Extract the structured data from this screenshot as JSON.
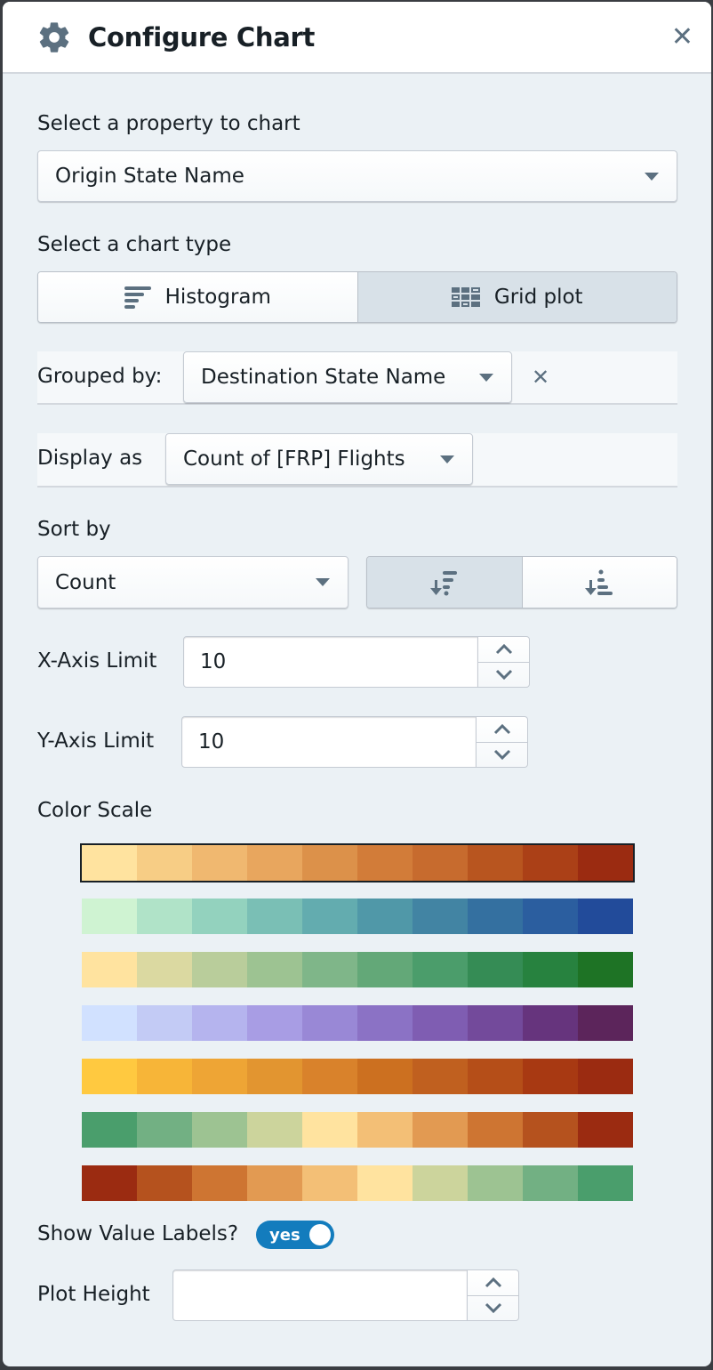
{
  "dialog": {
    "title": "Configure Chart",
    "title_icon": "gear-icon",
    "close_icon": "close-icon"
  },
  "property": {
    "label": "Select a property to chart",
    "value": "Origin State Name"
  },
  "chart_type": {
    "label": "Select a chart type",
    "options": [
      {
        "label": "Histogram",
        "icon": "histogram-icon",
        "active": false
      },
      {
        "label": "Grid plot",
        "icon": "grid-plot-icon",
        "active": true
      }
    ]
  },
  "grouped_by": {
    "label": "Grouped by:",
    "value": "Destination State Name"
  },
  "display_as": {
    "label": "Display as",
    "value": "Count of [FRP] Flights"
  },
  "sort": {
    "label": "Sort by",
    "value": "Count",
    "directions": [
      {
        "name": "sort-descending",
        "active": true
      },
      {
        "name": "sort-ascending",
        "active": false
      }
    ]
  },
  "x_axis_limit": {
    "label": "X-Axis Limit",
    "value": "10"
  },
  "y_axis_limit": {
    "label": "Y-Axis Limit",
    "value": "10"
  },
  "color_scale": {
    "label": "Color Scale",
    "selected_index": 0,
    "scales": [
      [
        "#ffe39f",
        "#f7cd85",
        "#f0b870",
        "#e8a65e",
        "#dc914a",
        "#d27c39",
        "#c76b2e",
        "#b8551f",
        "#ab4017",
        "#9b2b11"
      ],
      [
        "#cff3d2",
        "#b0e3c8",
        "#93d2be",
        "#7abfb5",
        "#63acaf",
        "#5098a8",
        "#4284a3",
        "#3470a0",
        "#2b5e9f",
        "#224b9a"
      ],
      [
        "#ffe39f",
        "#dbd9a1",
        "#b9cd9b",
        "#9dc392",
        "#7fb689",
        "#63a878",
        "#4b9d6b",
        "#358c55",
        "#27823f",
        "#1e7325"
      ],
      [
        "#d1e1ff",
        "#c3cbf5",
        "#b5b4ee",
        "#a89de4",
        "#9988d6",
        "#8b72c5",
        "#7f5db2",
        "#734a9b",
        "#66347d",
        "#5c255b"
      ],
      [
        "#ffc940",
        "#f7b538",
        "#eea535",
        "#e29530",
        "#d9822b",
        "#cc7020",
        "#c0601f",
        "#b54e18",
        "#a83912",
        "#9b2b11"
      ],
      [
        "#4a9e6c",
        "#72b083",
        "#9dc392",
        "#ccd49c",
        "#ffe39f",
        "#f3bf76",
        "#e29a52",
        "#ce7532",
        "#b5521e",
        "#9b2b11"
      ],
      [
        "#9b2b11",
        "#b5521e",
        "#ce7532",
        "#e29a52",
        "#f3bf76",
        "#ffe39f",
        "#ccd49c",
        "#9dc392",
        "#72b083",
        "#4a9e6c"
      ]
    ]
  },
  "show_value_labels": {
    "label": "Show Value Labels?",
    "value": "yes",
    "on": true
  },
  "plot_height": {
    "label": "Plot Height",
    "value": ""
  }
}
